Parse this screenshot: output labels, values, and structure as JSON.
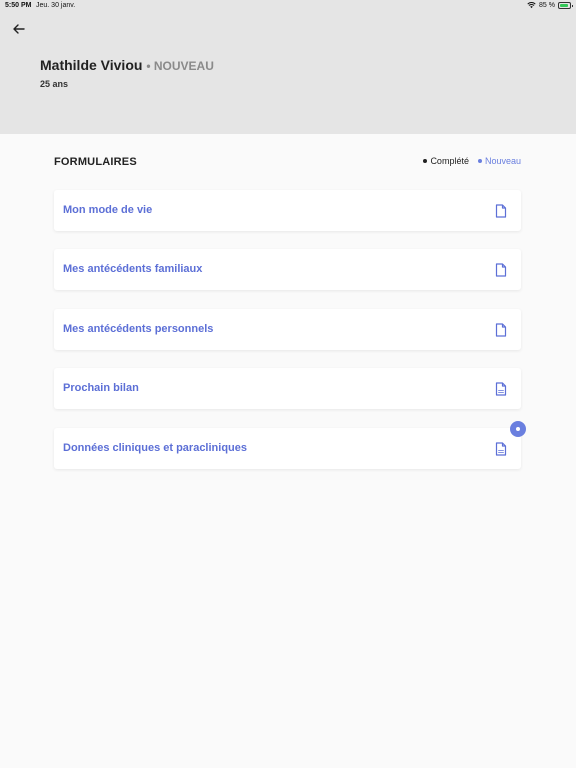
{
  "status_bar": {
    "time": "5:50 PM",
    "date": "Jeu. 30 janv.",
    "battery": "85 %"
  },
  "patient": {
    "name": "Mathilde Viviou",
    "status": "• NOUVEAU",
    "age": "25 ans"
  },
  "forms_section": {
    "title": "FORMULAIRES",
    "legend": {
      "complete": "Complété",
      "new": "Nouveau"
    }
  },
  "forms": [
    {
      "label": "Mon mode de vie",
      "icon": "document-icon"
    },
    {
      "label": "Mes antécédents familiaux",
      "icon": "document-icon"
    },
    {
      "label": "Mes antécédents personnels",
      "icon": "document-icon"
    },
    {
      "label": "Prochain bilan",
      "icon": "pdf-document-icon"
    },
    {
      "label": "Données cliniques et paracliniques",
      "icon": "pdf-document-icon",
      "is_new": true
    }
  ],
  "colors": {
    "accent": "#5c6fd6",
    "header_bg": "#e5e5e5",
    "page_bg": "#fafafa"
  }
}
